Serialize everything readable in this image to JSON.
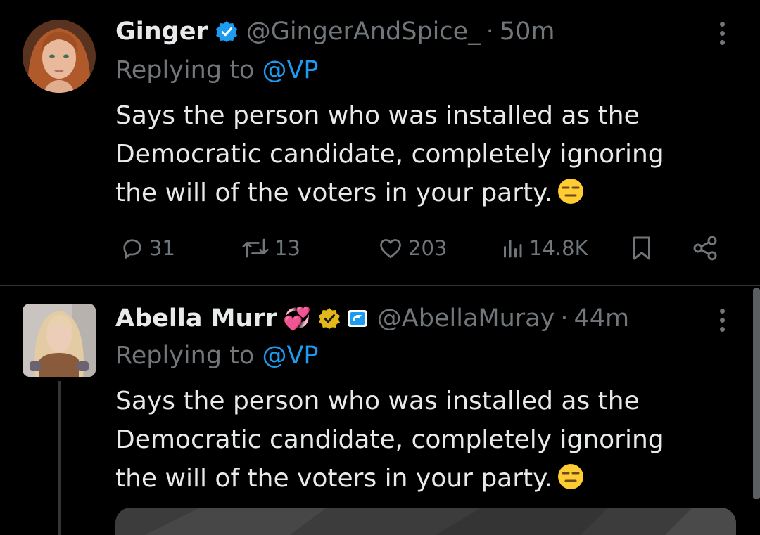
{
  "tweets": [
    {
      "author": {
        "display_name": "Ginger",
        "handle": "@GingerAndSpice_",
        "badges": [
          "blue-verified-icon"
        ]
      },
      "separator": "·",
      "time": "50m",
      "reply": {
        "prefix": "Replying to",
        "mention": "@VP"
      },
      "body_lines": [
        "Says the person who was installed as the",
        "Democratic candidate, completely ignoring",
        "the will of the voters in your party."
      ],
      "emoji": "expressionless-face-emoji",
      "stats": {
        "replies": "31",
        "reposts": "13",
        "likes": "203",
        "views": "14.8K"
      }
    },
    {
      "author": {
        "display_name": "Abella Murr",
        "handle": "@AbellaMuray",
        "name_emoji": "💞",
        "badges": [
          "gold-verified-icon",
          "affiliate-badge-icon"
        ]
      },
      "separator": "·",
      "time": "44m",
      "reply": {
        "prefix": "Replying to",
        "mention": "@VP"
      },
      "body_lines": [
        "Says the person who was installed as the",
        "Democratic candidate, completely ignoring",
        "the will of the voters in your party."
      ],
      "emoji": "expressionless-face-emoji"
    }
  ],
  "colors": {
    "background": "#000000",
    "text": "#e7e9ea",
    "muted": "#71767b",
    "accent": "#1d9bf0",
    "gold": "#e2b719",
    "divider": "#2f3336"
  }
}
